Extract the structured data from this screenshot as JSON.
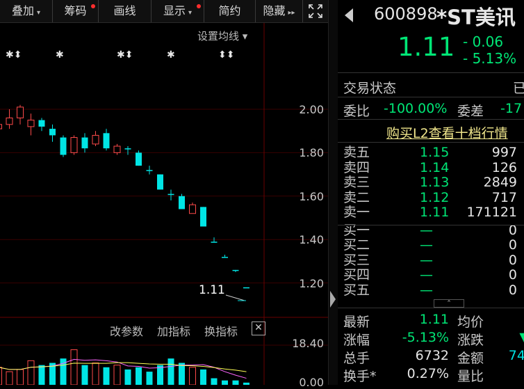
{
  "toolbar": {
    "items": [
      {
        "label": "叠加",
        "caret": "▾",
        "dot": false
      },
      {
        "label": "筹码",
        "caret": "",
        "dot": true
      },
      {
        "label": "画线",
        "caret": "",
        "dot": false
      },
      {
        "label": "显示",
        "caret": "▾",
        "dot": true
      },
      {
        "label": "简约",
        "caret": "",
        "dot": false
      },
      {
        "label": "隐藏",
        "caret": "▸▸",
        "dot": false
      }
    ],
    "fullscreen_icon": "expand-icon"
  },
  "chart": {
    "set_ma_label": "设置均线 ▾",
    "markers": [
      "✱⬍",
      "✱",
      "✱⬍",
      "✱",
      "⬍⬍"
    ],
    "price_ticks": [
      "2.00",
      "1.80",
      "1.60",
      "1.40",
      "1.20"
    ],
    "last_price_label": "1.11",
    "indicator_buttons": [
      "改参数",
      "加指标",
      "换指标"
    ],
    "close_icon": "close-icon",
    "vol_ticks": [
      "18.40",
      "0.00"
    ],
    "candles": [
      {
        "o": 1.91,
        "c": 1.93,
        "h": 2.02,
        "l": 1.88
      },
      {
        "o": 1.93,
        "c": 1.96,
        "h": 2.0,
        "l": 1.91
      },
      {
        "o": 1.96,
        "c": 2.01,
        "h": 2.02,
        "l": 1.93
      },
      {
        "o": 1.92,
        "c": 1.95,
        "h": 1.98,
        "l": 1.88
      },
      {
        "o": 1.95,
        "c": 1.92,
        "h": 1.96,
        "l": 1.9
      },
      {
        "o": 1.91,
        "c": 1.88,
        "h": 1.93,
        "l": 1.85
      },
      {
        "o": 1.87,
        "c": 1.79,
        "h": 1.88,
        "l": 1.78
      },
      {
        "o": 1.8,
        "c": 1.87,
        "h": 1.88,
        "l": 1.79
      },
      {
        "o": 1.87,
        "c": 1.82,
        "h": 1.89,
        "l": 1.8
      },
      {
        "o": 1.84,
        "c": 1.88,
        "h": 1.9,
        "l": 1.83
      },
      {
        "o": 1.89,
        "c": 1.82,
        "h": 1.91,
        "l": 1.81
      },
      {
        "o": 1.8,
        "c": 1.83,
        "h": 1.84,
        "l": 1.79
      },
      {
        "o": 1.82,
        "c": 1.82,
        "h": 1.83,
        "l": 1.79
      },
      {
        "o": 1.8,
        "c": 1.74,
        "h": 1.81,
        "l": 1.74
      },
      {
        "o": 1.72,
        "c": 1.72,
        "h": 1.74,
        "l": 1.7
      },
      {
        "o": 1.7,
        "c": 1.63,
        "h": 1.7,
        "l": 1.63
      },
      {
        "o": 1.61,
        "c": 1.61,
        "h": 1.63,
        "l": 1.58
      },
      {
        "o": 1.6,
        "c": 1.54,
        "h": 1.61,
        "l": 1.54
      },
      {
        "o": 1.52,
        "c": 1.56,
        "h": 1.57,
        "l": 1.52
      },
      {
        "o": 1.55,
        "c": 1.46,
        "h": 1.55,
        "l": 1.46
      },
      {
        "o": 1.39,
        "c": 1.39,
        "h": 1.41,
        "l": 1.39
      },
      {
        "o": 1.32,
        "c": 1.32,
        "h": 1.33,
        "l": 1.32
      },
      {
        "o": 1.26,
        "c": 1.26,
        "h": 1.26,
        "l": 1.25
      },
      {
        "o": 1.18,
        "c": 1.18,
        "h": 1.18,
        "l": 1.18
      }
    ],
    "volumes": [
      8,
      6,
      7,
      11,
      9,
      10,
      12,
      16,
      9,
      10,
      8,
      9,
      7,
      8,
      6,
      9,
      12,
      10,
      8,
      7,
      3,
      2,
      2,
      1
    ]
  },
  "quote": {
    "code": "600898",
    "name": "*ST美讯",
    "price": "1.11",
    "change": "- 0.06",
    "change_pct": "- 5.13%",
    "trade_status_label": "交易状态",
    "trade_status_value": "已",
    "weibi_label": "委比",
    "weibi_value": "-100.00%",
    "weicha_label": "委差",
    "weicha_value": "-17",
    "l2_link": "购买L2查看十档行情",
    "sells": [
      {
        "label": "卖五",
        "price": "1.15",
        "vol": "997"
      },
      {
        "label": "卖四",
        "price": "1.14",
        "vol": "126"
      },
      {
        "label": "卖三",
        "price": "1.13",
        "vol": "2849"
      },
      {
        "label": "卖二",
        "price": "1.12",
        "vol": "717"
      },
      {
        "label": "卖一",
        "price": "1.11",
        "vol": "171121"
      }
    ],
    "buys": [
      {
        "label": "买一",
        "price": "—",
        "vol": "0"
      },
      {
        "label": "买二",
        "price": "—",
        "vol": "0"
      },
      {
        "label": "买三",
        "price": "—",
        "vol": "0"
      },
      {
        "label": "买四",
        "price": "—",
        "vol": "0"
      },
      {
        "label": "买五",
        "price": "—",
        "vol": "0"
      }
    ],
    "stats": [
      {
        "l1": "最新",
        "v1": "1.11",
        "l2": "均价",
        "v2": ""
      },
      {
        "l1": "涨幅",
        "v1": "-5.13%",
        "l2": "涨跌",
        "v2": "▼"
      },
      {
        "l1": "总手",
        "v1": "6732",
        "l2": "金额",
        "v2": "74."
      },
      {
        "l1": "换手*",
        "v1": "0.27%",
        "l2": "量比",
        "v2": ""
      }
    ]
  }
}
